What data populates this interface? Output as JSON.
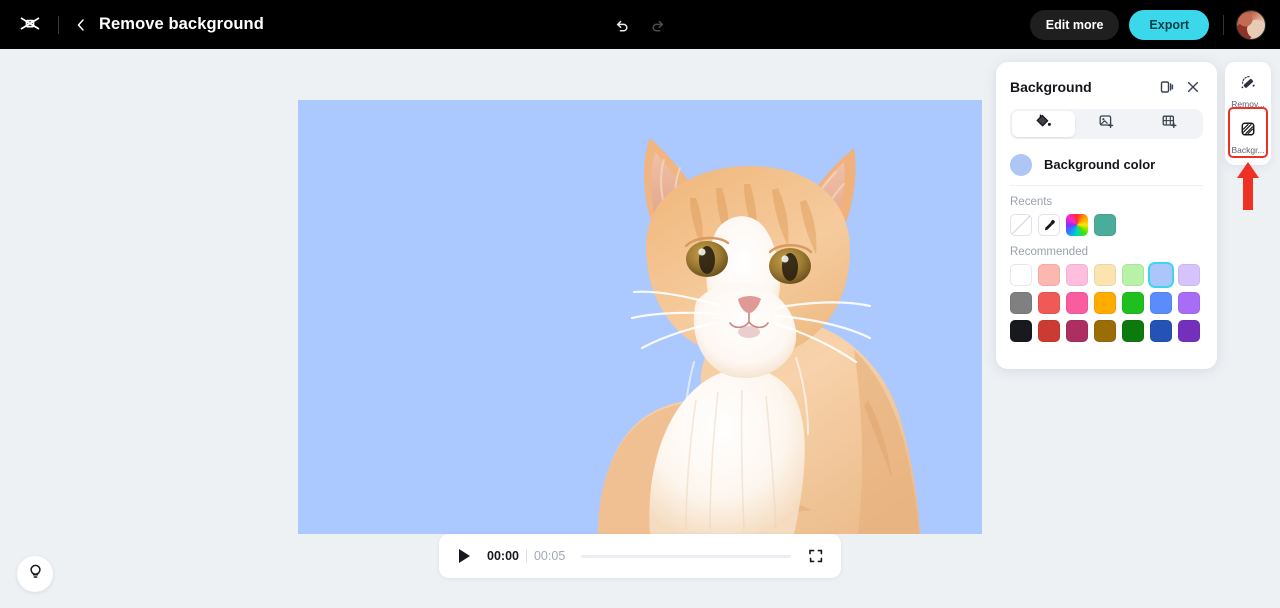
{
  "topbar": {
    "logo_icon": "capcut-logo-icon",
    "back_icon": "chevron-left-icon",
    "title": "Remove background",
    "undo_icon": "undo-arrow-icon",
    "redo_icon": "redo-arrow-icon",
    "edit_more_label": "Edit more",
    "export_label": "Export",
    "avatar_name": "user-avatar"
  },
  "canvas": {
    "background_color": "#abc8ff",
    "subject": "orange-tabby-cat-cutout"
  },
  "player": {
    "play_icon": "play-icon",
    "current_time": "00:00",
    "total_time": "00:05",
    "progress_percent": 0,
    "fullscreen_icon": "fullscreen-icon"
  },
  "tips": {
    "icon": "lightbulb-icon"
  },
  "panel": {
    "title": "Background",
    "dock_icon": "dock-panel-icon",
    "close_icon": "close-icon",
    "tabs": [
      {
        "name": "color",
        "icon": "paint-bucket-icon",
        "active": true
      },
      {
        "name": "image",
        "icon": "add-image-icon",
        "active": false
      },
      {
        "name": "video",
        "icon": "add-video-icon",
        "active": false
      }
    ],
    "background_color_label": "Background color",
    "background_color_value": "#adc6f5",
    "recents_label": "Recents",
    "recents": [
      {
        "name": "transparent",
        "kind": "transparent",
        "color": ""
      },
      {
        "name": "eyedropper",
        "kind": "eyedropper",
        "color": ""
      },
      {
        "name": "color-wheel",
        "kind": "wheel",
        "color": ""
      },
      {
        "name": "teal",
        "kind": "solid",
        "color": "#4aad9a"
      }
    ],
    "recommended_label": "Recommended",
    "recommended_rows": [
      [
        {
          "color": "#ffffff",
          "selected": false
        },
        {
          "color": "#fcb8b0",
          "selected": false
        },
        {
          "color": "#ffbedd",
          "selected": false
        },
        {
          "color": "#fce4b0",
          "selected": false
        },
        {
          "color": "#b8f1a8",
          "selected": false
        },
        {
          "color": "#acc6fb",
          "selected": true
        },
        {
          "color": "#d7c3fb",
          "selected": false
        }
      ],
      [
        {
          "color": "#808080",
          "selected": false
        },
        {
          "color": "#ef5a56",
          "selected": false
        },
        {
          "color": "#fa5ca0",
          "selected": false
        },
        {
          "color": "#ffab00",
          "selected": false
        },
        {
          "color": "#1fbf1f",
          "selected": false
        },
        {
          "color": "#5b8cfb",
          "selected": false
        },
        {
          "color": "#a86cf5",
          "selected": false
        }
      ],
      [
        {
          "color": "#17191f",
          "selected": false
        },
        {
          "color": "#cc3b33",
          "selected": false
        },
        {
          "color": "#ad2e61",
          "selected": false
        },
        {
          "color": "#9a6d05",
          "selected": false
        },
        {
          "color": "#0d7a0d",
          "selected": false
        },
        {
          "color": "#2452b5",
          "selected": false
        },
        {
          "color": "#7430bd",
          "selected": false
        }
      ]
    ]
  },
  "rail": {
    "items": [
      {
        "name": "remove-background",
        "icon": "magic-wand-icon",
        "label": "Remov...",
        "active": false
      },
      {
        "name": "background",
        "icon": "background-fill-icon",
        "label": "Backgr...",
        "active": true
      }
    ]
  },
  "annotation": {
    "color": "#ef3124",
    "target": "background-rail-button"
  }
}
